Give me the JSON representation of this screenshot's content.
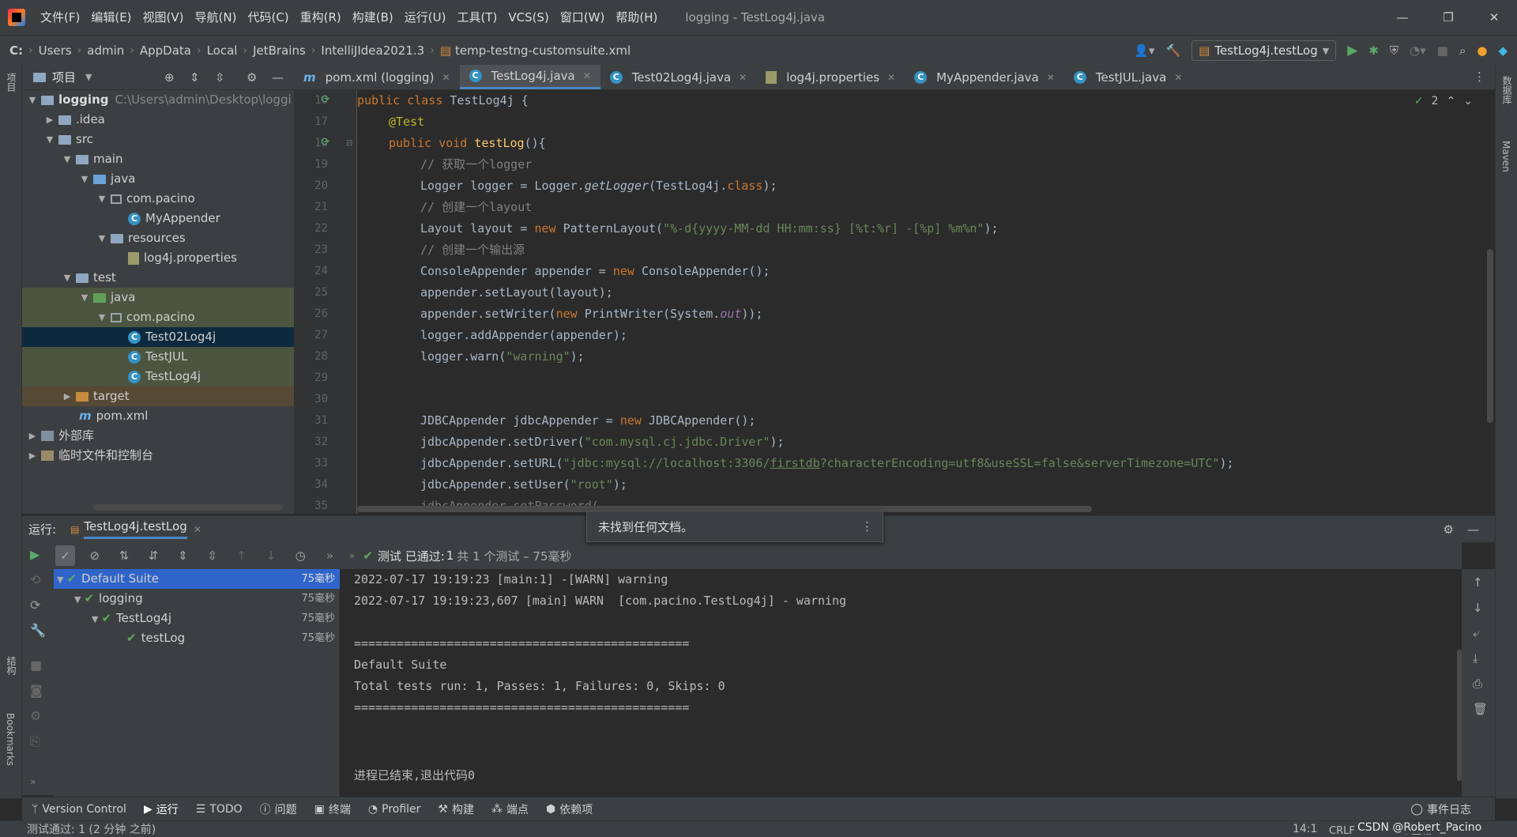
{
  "menubar": {
    "items": [
      "文件(F)",
      "编辑(E)",
      "视图(V)",
      "导航(N)",
      "代码(C)",
      "重构(R)",
      "构建(B)",
      "运行(U)",
      "工具(T)",
      "VCS(S)",
      "窗口(W)",
      "帮助(H)"
    ],
    "title": "logging - TestLog4j.java"
  },
  "breadcrumb": [
    "C:",
    "Users",
    "admin",
    "AppData",
    "Local",
    "JetBrains",
    "IntelliJIdea2021.3",
    "temp-testng-customsuite.xml"
  ],
  "run_config": "TestLog4j.testLog",
  "project": {
    "title": "项目",
    "root_name": "logging",
    "root_path": "C:\\Users\\admin\\Desktop\\loggi",
    "nodes": [
      ".idea",
      "src",
      "main",
      "java",
      "com.pacino",
      "MyAppender",
      "resources",
      "log4j.properties",
      "test",
      "java",
      "com.pacino",
      "Test02Log4j",
      "TestJUL",
      "TestLog4j",
      "target",
      "pom.xml",
      "外部库",
      "临时文件和控制台"
    ]
  },
  "left_strip": {
    "project": "项目",
    "structure": "结构",
    "bookmarks": "Bookmarks"
  },
  "right_strip": {
    "database": "数据库",
    "maven": "Maven"
  },
  "tabs": [
    "pom.xml (logging)",
    "TestLog4j.java",
    "Test02Log4j.java",
    "log4j.properties",
    "MyAppender.java",
    "TestJUL.java"
  ],
  "editor": {
    "line_start": 16,
    "inspection_count": "2"
  },
  "tooltip": "未找到任何文档。",
  "run": {
    "label": "运行:",
    "tab": "TestLog4j.testLog",
    "status_prefix": "测试 已通过:",
    "status_count": "1",
    "status_detail": "共 1 个测试 – 75毫秒",
    "tree": [
      {
        "name": "Default Suite",
        "time": "75毫秒"
      },
      {
        "name": "logging",
        "time": "75毫秒"
      },
      {
        "name": "TestLog4j",
        "time": "75毫秒"
      },
      {
        "name": "testLog",
        "time": "75毫秒"
      }
    ],
    "console": [
      "2022-07-17 19:19:23 [main:1] -[WARN] warning",
      "2022-07-17 19:19:23,607 [main] WARN  [com.pacino.TestLog4j] - warning",
      "",
      "===============================================",
      "Default Suite",
      "Total tests run: 1, Passes: 1, Failures: 0, Skips: 0",
      "===============================================",
      "",
      "",
      "进程已结束,退出代码0"
    ]
  },
  "bottom_tabs": [
    "Version Control",
    "运行",
    "TODO",
    "问题",
    "终端",
    "Profiler",
    "构建",
    "端点",
    "依赖项"
  ],
  "event_log": "事件日志",
  "status": {
    "message": "测试通过: 1 (2 分钟 之前)",
    "position": "14:1",
    "encoding": "CRLF  UTF-8  4 个空格",
    "watermark": "CSDN @Robert_Pacino"
  }
}
